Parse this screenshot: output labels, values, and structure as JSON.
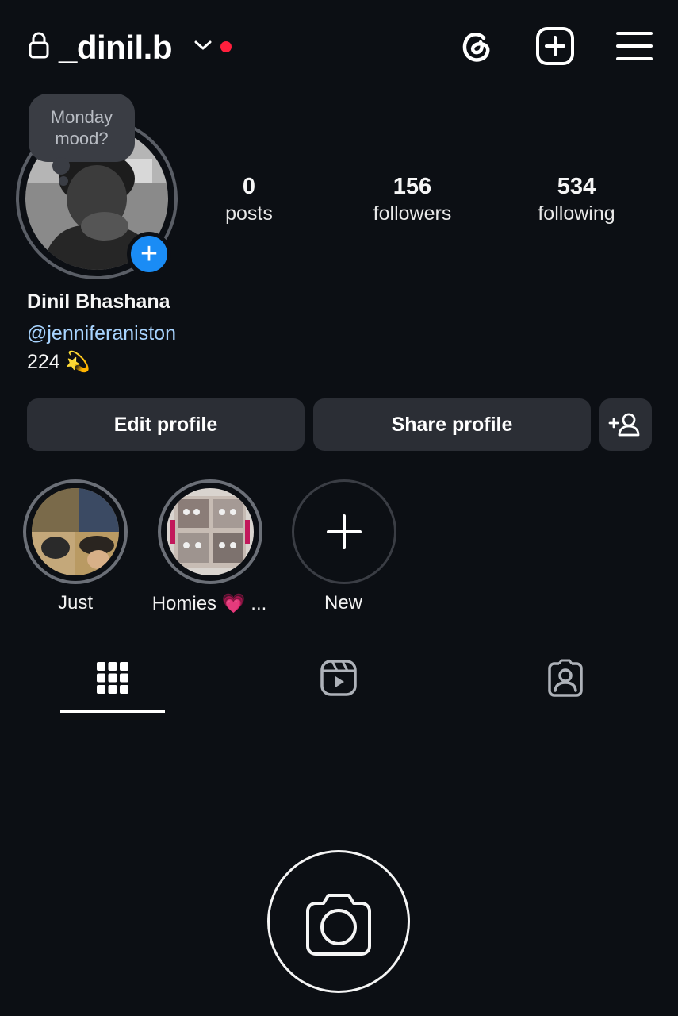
{
  "header": {
    "username": "_dinil.b",
    "icons": [
      "lock-icon",
      "chevron-down-icon",
      "threads-icon",
      "create-post-icon",
      "menu-icon"
    ]
  },
  "note": {
    "text_line1": "Monday",
    "text_line2": "mood?"
  },
  "stats": [
    {
      "value": "0",
      "label": "posts"
    },
    {
      "value": "156",
      "label": "followers"
    },
    {
      "value": "534",
      "label": "following"
    }
  ],
  "profile": {
    "name": "Dinil Bhashana",
    "handle": "@jenniferaniston",
    "bio": "224 💫"
  },
  "buttons": {
    "edit": "Edit profile",
    "share": "Share profile"
  },
  "highlights": [
    {
      "label": "Just"
    },
    {
      "label": "Homies 💗 ..."
    },
    {
      "label": "New"
    }
  ],
  "colors": {
    "background": "#0c0f14",
    "accent_blue": "#1a8cf5",
    "notification_red": "#ff1f3d",
    "button_bg": "#2b2e35",
    "link_blue": "#a8d4ff"
  }
}
